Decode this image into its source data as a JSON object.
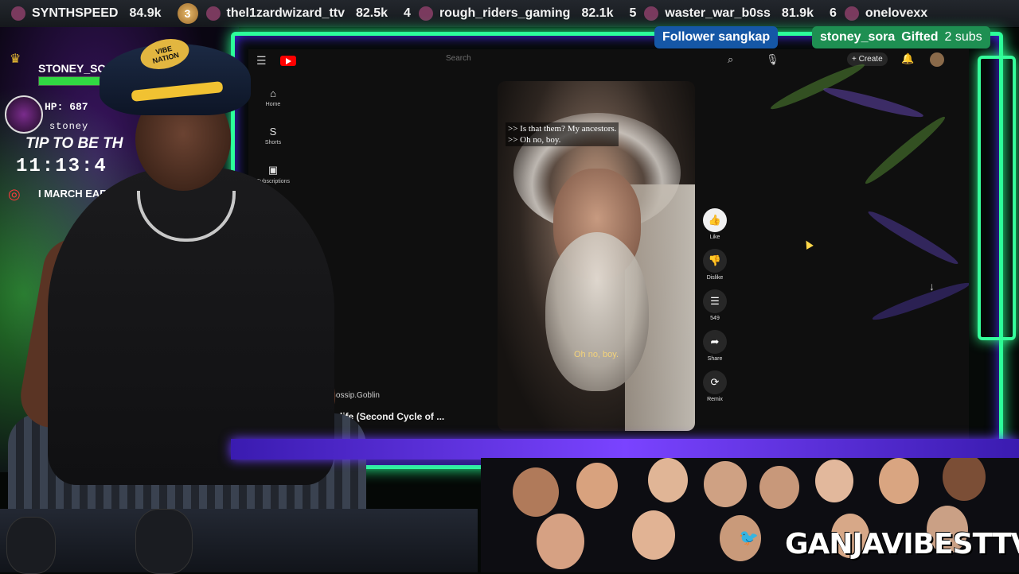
{
  "ticker": {
    "items": [
      {
        "rank": "",
        "name": "SYNTHSPEED",
        "value": "84.9k"
      },
      {
        "rank": "3",
        "name": "thel1zardwizard_ttv",
        "value": "82.5k"
      },
      {
        "rank": "4",
        "name": "rough_riders_gaming",
        "value": "82.1k"
      },
      {
        "rank": "5",
        "name": "waster_war_b0ss",
        "value": "81.9k"
      },
      {
        "rank": "6",
        "name": "onelovexx",
        "value": ""
      }
    ]
  },
  "alerts": {
    "follower_label": "Follower",
    "follower_name": "sangkap",
    "gift_name": "stoney_sora",
    "gift_label": "Gifted",
    "gift_count": "2 subs"
  },
  "overlay": {
    "player_name": "STONEY_SORA",
    "hp_text": "HP: 687",
    "hp_fraction": 0.92,
    "handle": "stoney",
    "tip_text": "TIP TO BE TH",
    "timer_text": "11:13:4",
    "march_text": "I MARCH EARNI",
    "hat_badge": "VIBE\nNATION"
  },
  "youtube": {
    "search_placeholder": "Search",
    "create_label": "+ Create",
    "sidebar": [
      {
        "icon": "home-icon",
        "glyph": "⌂",
        "label": "Home"
      },
      {
        "icon": "shorts-icon",
        "glyph": "S",
        "label": "Shorts"
      },
      {
        "icon": "subscriptions-icon",
        "glyph": "▣",
        "label": "Subscriptions"
      }
    ],
    "video": {
      "caption_line1": ">> Is that them? My ancestors.",
      "caption_line2": ">> Oh no, boy.",
      "subtitle": "Oh no, boy.",
      "progress": 0.66,
      "channel": "@Gossip.Goblin",
      "title": "he Afterlife (Second Cycle of ..."
    },
    "actions": [
      {
        "icon": "like-icon",
        "glyph": "👍",
        "label": "Like",
        "active": true
      },
      {
        "icon": "dislike-icon",
        "glyph": "👎",
        "label": "Dislike",
        "active": false
      },
      {
        "icon": "comment-icon",
        "glyph": "☰",
        "label": "549",
        "active": false
      },
      {
        "icon": "share-icon",
        "glyph": "➦",
        "label": "Share",
        "active": false
      },
      {
        "icon": "remix-icon",
        "glyph": "⟳",
        "label": "Remix",
        "active": false
      }
    ]
  },
  "brand": {
    "text": "GANJAVIBESTTV",
    "accent": "#3aa7ff"
  },
  "colors": {
    "neon_green": "#2cff9a",
    "neon_purple": "#7a43ff",
    "follow_blue": "#1557a6",
    "gift_green": "#1e8f52"
  }
}
